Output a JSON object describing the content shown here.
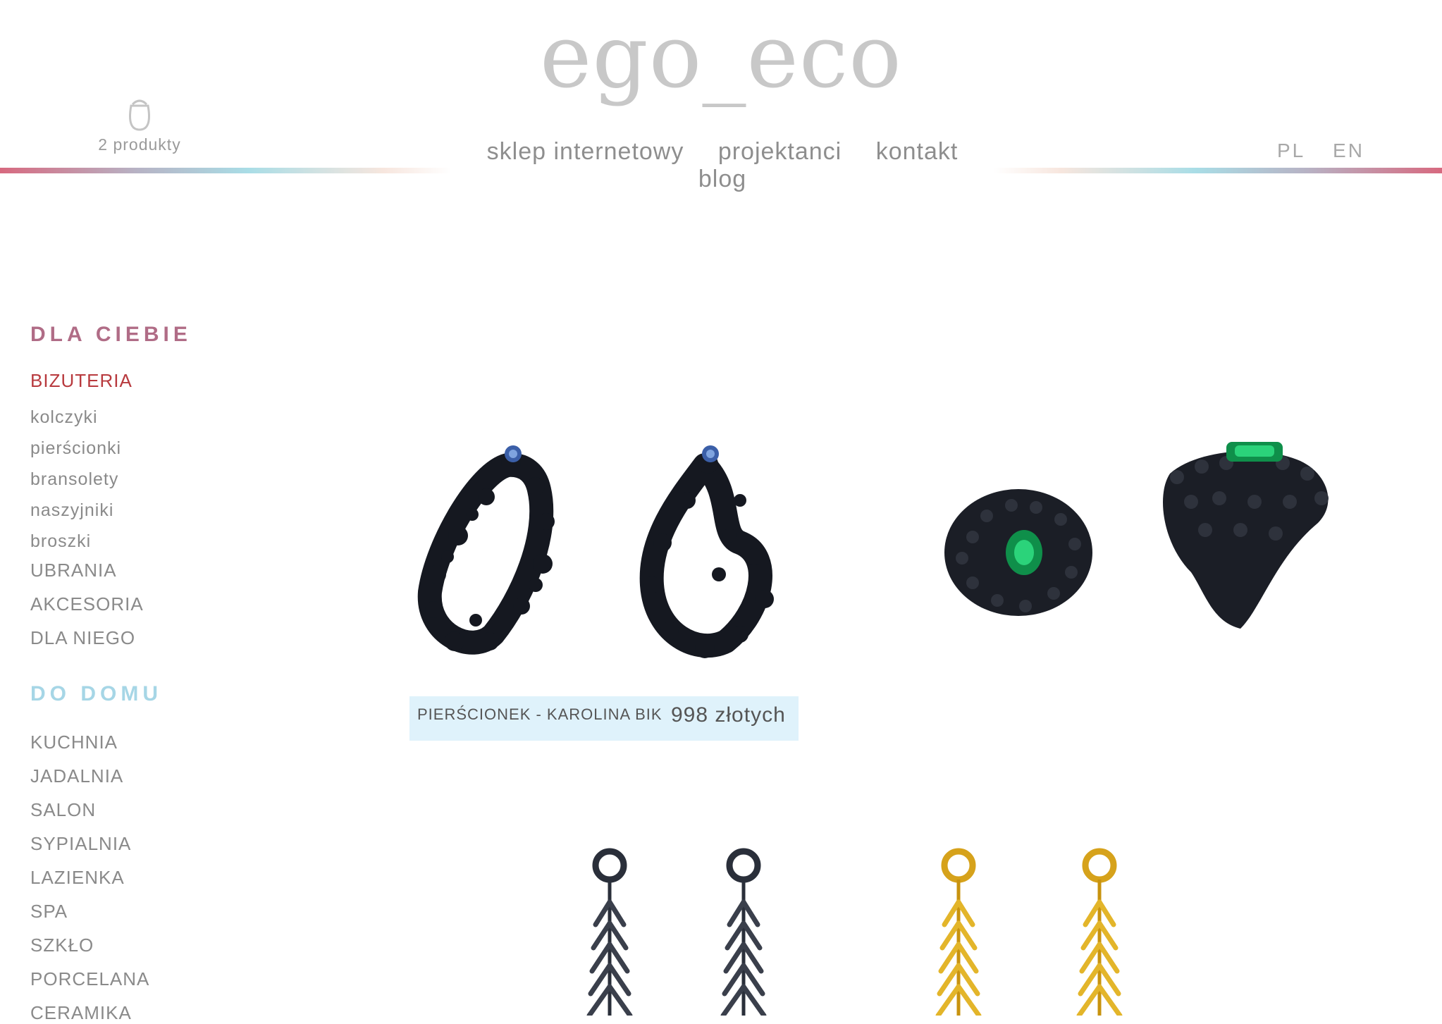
{
  "brand": {
    "logo": "ego_eco"
  },
  "cart": {
    "count_label": "2 produkty",
    "icon": "bag-icon"
  },
  "nav": {
    "items": [
      "sklep internetowy",
      "projektanci",
      "kontakt",
      "blog"
    ]
  },
  "language": {
    "options": [
      "PL",
      "EN"
    ]
  },
  "sidebar": {
    "section1": {
      "title": "DLA CIEBIE",
      "categories": [
        {
          "label": "BIZUTERIA",
          "active": true
        },
        {
          "label": "kolczyki"
        },
        {
          "label": "pierścionki"
        },
        {
          "label": "bransolety"
        },
        {
          "label": "naszyjniki"
        },
        {
          "label": "broszki"
        },
        {
          "label": "UBRANIA"
        },
        {
          "label": "AKCESORIA"
        },
        {
          "label": "DLA NIEGO"
        }
      ]
    },
    "section2": {
      "title": "DO DOMU",
      "categories": [
        {
          "label": "KUCHNIA"
        },
        {
          "label": "JADALNIA"
        },
        {
          "label": "SALON"
        },
        {
          "label": "SYPIALNIA"
        },
        {
          "label": "LAZIENKA"
        },
        {
          "label": "SPA"
        },
        {
          "label": "SZKŁO"
        },
        {
          "label": "PORCELANA"
        },
        {
          "label": "CERAMIKA"
        }
      ]
    }
  },
  "products": [
    {
      "name": "PIERŚCIONEK - KAROLINA BIK",
      "price": "998 złotych"
    }
  ],
  "colors": {
    "logo": "#c8c8c8",
    "section_pink": "#b06c86",
    "section_blue": "#a6d6e6",
    "active_category": "#b83a3e",
    "caption_bg": "#dff2fb"
  }
}
